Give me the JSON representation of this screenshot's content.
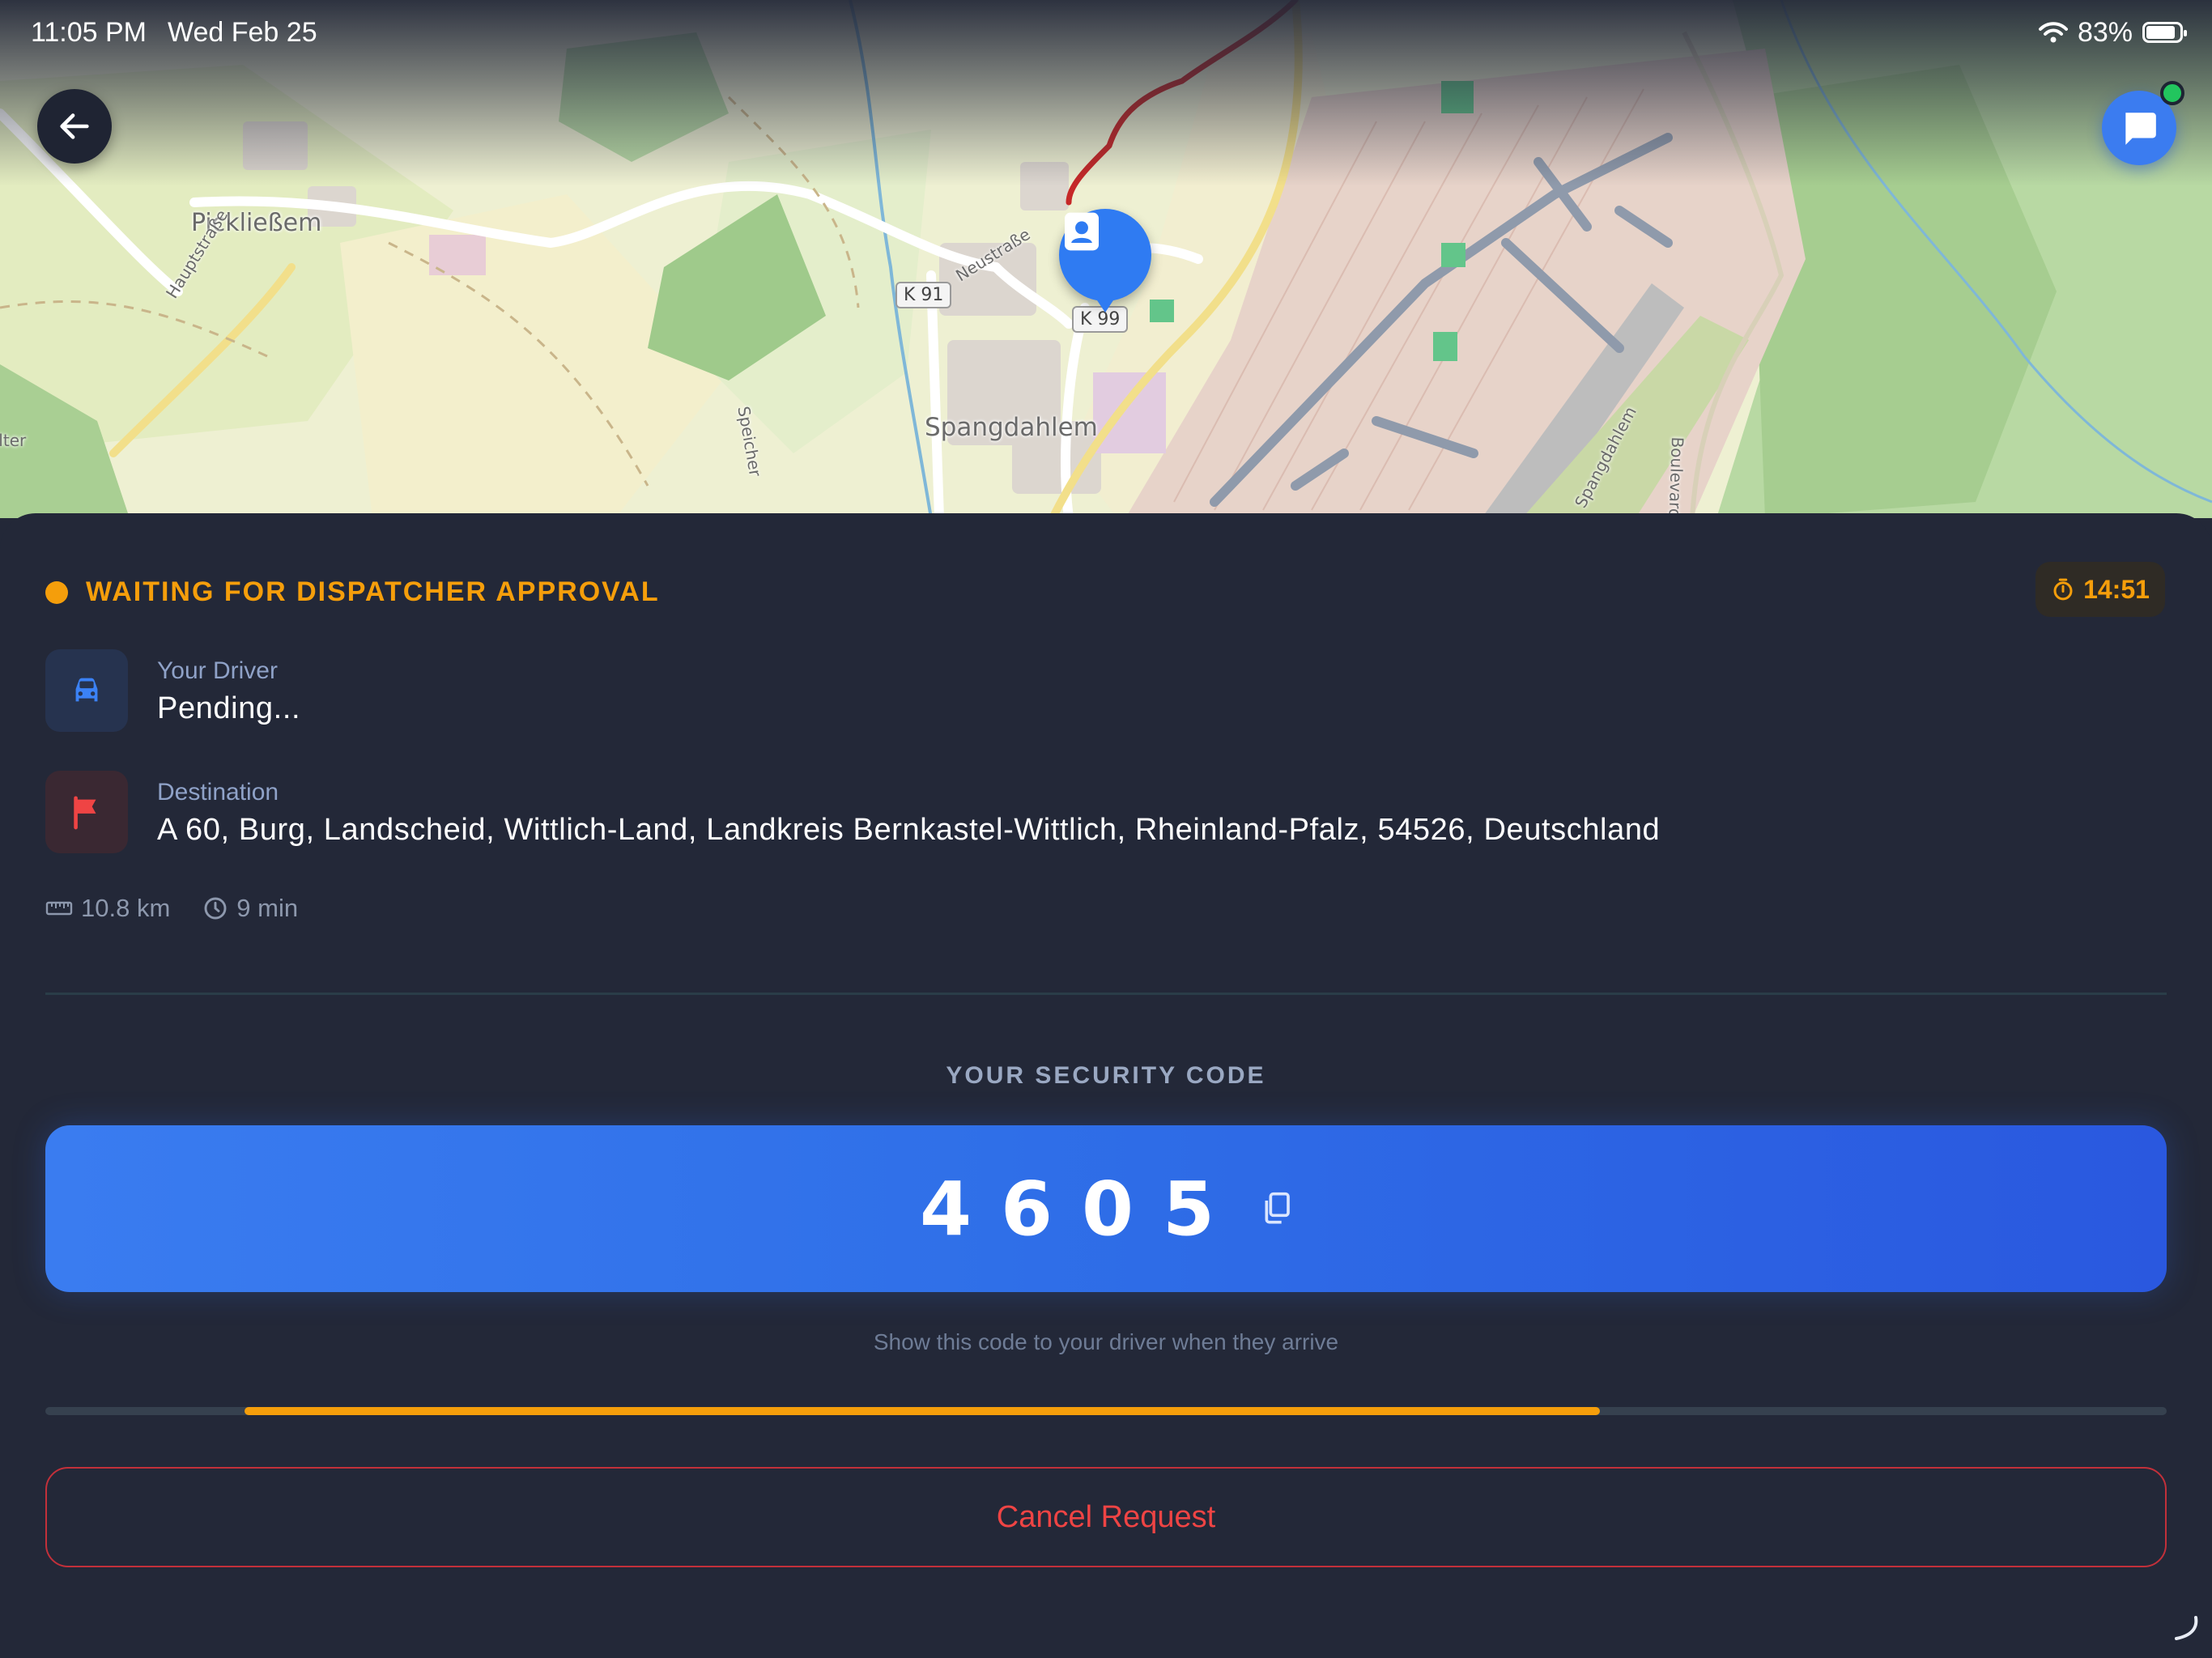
{
  "status_bar": {
    "time": "11:05 PM",
    "date": "Wed Feb 25",
    "battery": "83%"
  },
  "map": {
    "place_labels": [
      "Pickließem",
      "Spangdahlem"
    ],
    "road_labels": [
      "Hauptstraße",
      "Neustraße",
      "Speicher",
      "Spangdahlem",
      "Boulevard",
      "elter"
    ],
    "road_shields": [
      "K 91",
      "K 99"
    ]
  },
  "ride": {
    "status": "WAITING FOR DISPATCHER APPROVAL",
    "timer": "14:51",
    "driver_label": "Your Driver",
    "driver_value": "Pending...",
    "destination_label": "Destination",
    "destination_value": "A 60, Burg, Landscheid, Wittlich-Land, Landkreis Bernkastel-Wittlich, Rheinland-Pfalz, 54526, Deutschland",
    "distance": "10.8 km",
    "duration": "9 min"
  },
  "security": {
    "label": "YOUR SECURITY CODE",
    "code": "4605",
    "hint": "Show this code to your driver when they arrive"
  },
  "progress": {
    "start_fraction": 0.094,
    "end_fraction": 0.733
  },
  "actions": {
    "cancel_label": "Cancel Request"
  },
  "colors": {
    "accent": "#2f6fe8",
    "warning": "#f59e0b",
    "danger": "#ef4444",
    "background": "#232838",
    "online": "#22c55e"
  },
  "icons": [
    "back-arrow-icon",
    "chat-icon",
    "user-pin-icon",
    "car-icon",
    "flag-icon",
    "ruler-icon",
    "clock-icon",
    "stopwatch-icon",
    "copy-icon",
    "wifi-icon",
    "battery-icon"
  ]
}
